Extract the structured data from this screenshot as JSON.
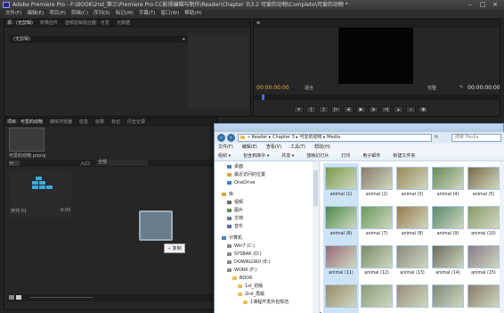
{
  "premiere": {
    "title": "Adobe Premiere Pro - F:\\BOOK\\2nd_第三\\Premiere Pro CC影视编辑与制作\\Reader\\Chapter 3\\3.2 可爱的动物\\Complete\\可爱的动物 *",
    "menu": [
      "文件(F)",
      "编辑(E)",
      "项目(P)",
      "剪辑(C)",
      "序列(S)",
      "标记(M)",
      "字幕(T)",
      "窗口(W)",
      "帮助(H)"
    ],
    "source_tabs": [
      "源：(无剪辑)",
      "效果控件",
      "音频剪辑混合器：可爱",
      "元数据"
    ],
    "source_dropdown": "(无剪辑)",
    "program": {
      "timecode_left": "00:00:00:00",
      "fit": "适合",
      "quality": "完整",
      "timecode_right": "00:00:00:00"
    },
    "project_tabs": [
      "项目：可爱的动物",
      "媒体浏览器",
      "信息",
      "效果",
      "标记",
      "历史记录"
    ],
    "project_file": "可爱的动物.prproj",
    "in_label": "入口：",
    "in_value": "全部",
    "seq_label": "序列 01",
    "seq_count": "0:00",
    "drag_tip": "复制"
  },
  "explorer": {
    "address": "« Reader ▸ Chapter 3 ▸ 可爱的动物 ▸ Media",
    "search_placeholder": "搜索 Media",
    "menu": [
      "文件(F)",
      "编辑(E)",
      "查看(V)",
      "工具(T)",
      "帮助(H)"
    ],
    "toolbar": [
      "组织 ▾",
      "包含到库中 ▾",
      "共享 ▾",
      "放映幻灯片",
      "打印",
      "电子邮件",
      "新建文件夹"
    ],
    "tree": [
      {
        "label": "桌面",
        "indent": 2,
        "color": "#4a7fc1"
      },
      {
        "label": "最近访问的位置",
        "indent": 2,
        "color": "#d9a441"
      },
      {
        "label": "OneDrive",
        "indent": 2,
        "color": "#3d7bd4"
      },
      {
        "label": "",
        "indent": 0,
        "color": ""
      },
      {
        "label": "库",
        "indent": 1,
        "color": "#d9a441"
      },
      {
        "label": "视频",
        "indent": 2,
        "color": "#6a6a6a"
      },
      {
        "label": "图片",
        "indent": 2,
        "color": "#5a8a5a"
      },
      {
        "label": "文档",
        "indent": 2,
        "color": "#6a7a9a"
      },
      {
        "label": "音乐",
        "indent": 2,
        "color": "#5a6aaa"
      },
      {
        "label": "",
        "indent": 0,
        "color": ""
      },
      {
        "label": "计算机",
        "indent": 1,
        "color": "#4a7fc1"
      },
      {
        "label": "Win7 (C:)",
        "indent": 2,
        "color": "#8a8a8a"
      },
      {
        "label": "SYSBAK (D:)",
        "indent": 2,
        "color": "#8a8a8a"
      },
      {
        "label": "DOWNLOAD (E:)",
        "indent": 2,
        "color": "#8a8a8a"
      },
      {
        "label": "WORK (F:)",
        "indent": 2,
        "color": "#8a8a8a"
      },
      {
        "label": "BOOK",
        "indent": 3,
        "color": "#e8c15a"
      },
      {
        "label": "1st_初版",
        "indent": 4,
        "color": "#e8c15a"
      },
      {
        "label": "2nd_再版",
        "indent": 4,
        "color": "#e8c15a"
      },
      {
        "label": "1课程开发外包规范",
        "indent": 5,
        "color": "#e8c15a"
      }
    ],
    "files": [
      {
        "label": "animal (1)",
        "color": "#7a9a4a",
        "selected": true
      },
      {
        "label": "animal (2)",
        "color": "#8a7a6a",
        "selected": false
      },
      {
        "label": "animal (3)",
        "color": "#9a8a5a",
        "selected": false
      },
      {
        "label": "animal (4)",
        "color": "#6a8a5a",
        "selected": false
      },
      {
        "label": "animal (5)",
        "color": "#7a6a4a",
        "selected": false
      },
      {
        "label": "animal (6)",
        "color": "#4a8a4a",
        "selected": true
      },
      {
        "label": "animal (7)",
        "color": "#6a9a5a",
        "selected": false
      },
      {
        "label": "animal (8)",
        "color": "#9a7a4a",
        "selected": false
      },
      {
        "label": "animal (9)",
        "color": "#5a8a6a",
        "selected": false
      },
      {
        "label": "animal (10)",
        "color": "#8a9a6a",
        "selected": false
      },
      {
        "label": "animal (11)",
        "color": "#9a6a7a",
        "selected": true
      },
      {
        "label": "animal (12)",
        "color": "#7a8a6a",
        "selected": false
      },
      {
        "label": "animal (13)",
        "color": "#8a8a7a",
        "selected": false
      },
      {
        "label": "animal (14)",
        "color": "#6a6a5a",
        "selected": false
      },
      {
        "label": "animal (15)",
        "color": "#8a7a8a",
        "selected": false
      },
      {
        "label": "",
        "color": "#9a8a6a",
        "selected": true
      },
      {
        "label": "",
        "color": "#8a9a7a",
        "selected": false
      },
      {
        "label": "",
        "color": "#9a8a7a",
        "selected": false
      },
      {
        "label": "",
        "color": "#7a8a7a",
        "selected": false
      },
      {
        "label": "",
        "color": "#8a7a6a",
        "selected": false
      }
    ]
  }
}
